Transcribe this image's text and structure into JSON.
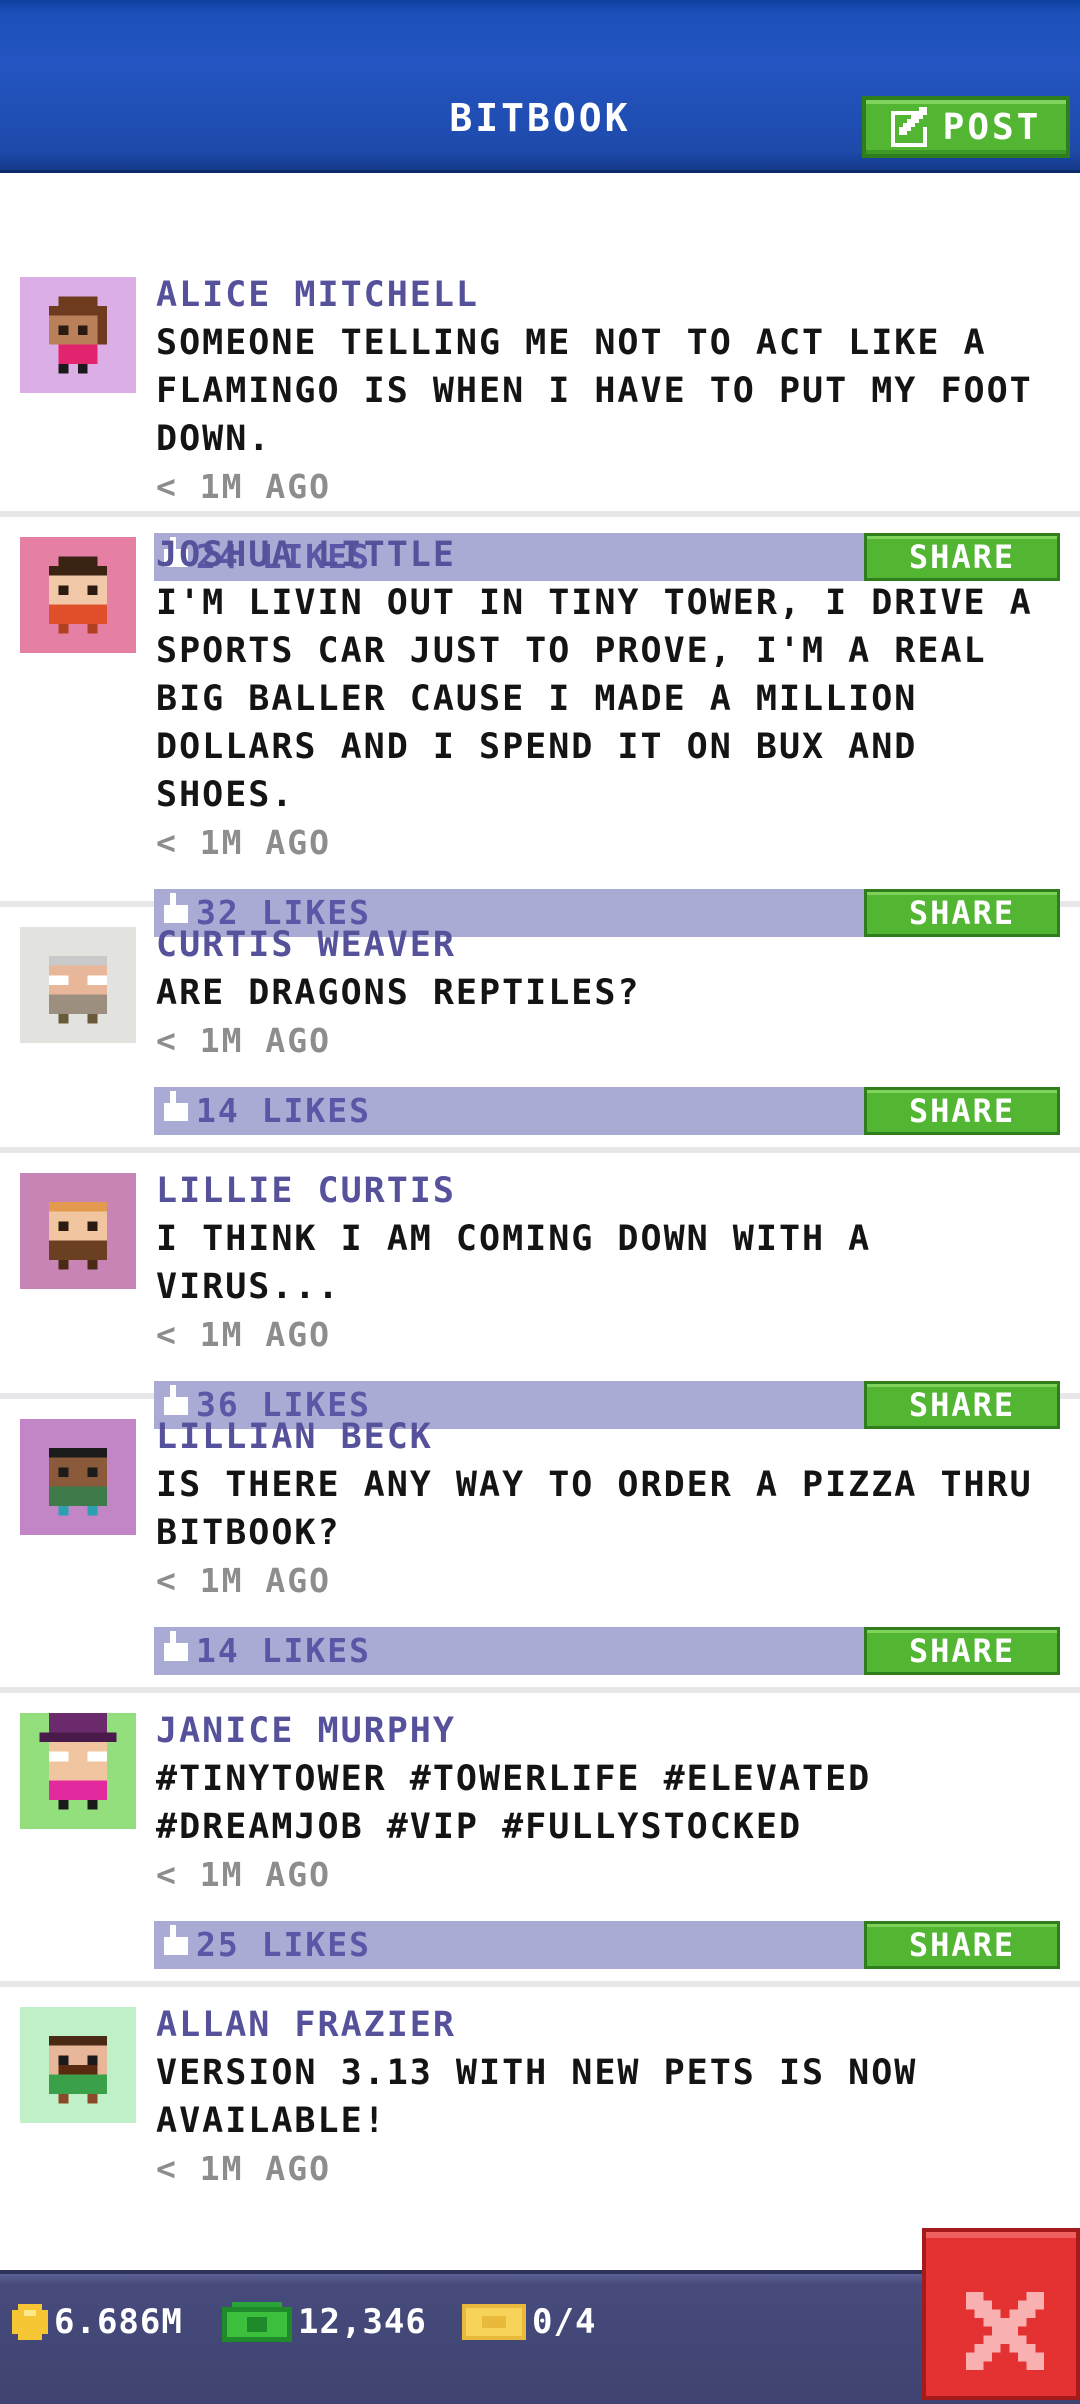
{
  "header": {
    "title": "BITBOOK",
    "post_label": "POST"
  },
  "colors": {
    "header_blue": "#1e4aab",
    "accent_green": "#53b633",
    "likes_bar": "#a9abd4",
    "author_purple": "#55519b",
    "close_red": "#e43131"
  },
  "posts": [
    {
      "author": "ALICE MITCHELL",
      "text": "SOMEONE TELLING ME NOT TO ACT LIKE A FLAMINGO IS WHEN I HAVE TO PUT MY FOOT DOWN.",
      "time": "< 1M AGO",
      "likes": "24 LIKES",
      "share_label": "SHARE",
      "avatar_bg": "#dcaee6"
    },
    {
      "author": "JOSHUA LITTLE",
      "text": "I'M LIVIN OUT IN TINY TOWER, I DRIVE A SPORTS CAR JUST TO PROVE, I'M A REAL BIG BALLER CAUSE I MADE A MILLION DOLLARS AND I SPEND IT ON BUX AND SHOES.",
      "time": "< 1M AGO",
      "likes": "32 LIKES",
      "share_label": "SHARE",
      "avatar_bg": "#e57fa3"
    },
    {
      "author": "CURTIS WEAVER",
      "text": "ARE DRAGONS REPTILES?",
      "time": "< 1M AGO",
      "likes": "14 LIKES",
      "share_label": "SHARE",
      "avatar_bg": "#e2e3df"
    },
    {
      "author": "LILLIE CURTIS",
      "text": "I THINK I AM COMING DOWN WITH A VIRUS...",
      "time": "< 1M AGO",
      "likes": "36 LIKES",
      "share_label": "SHARE",
      "avatar_bg": "#c784b4"
    },
    {
      "author": "LILLIAN BECK",
      "text": "IS THERE ANY WAY TO ORDER A PIZZA THRU BITBOOK?",
      "time": "< 1M AGO",
      "likes": "14 LIKES",
      "share_label": "SHARE",
      "avatar_bg": "#c285c6"
    },
    {
      "author": "JANICE MURPHY",
      "text": "#TINYTOWER #TOWERLIFE #ELEVATED #DREAMJOB #VIP #FULLYSTOCKED",
      "time": "< 1M AGO",
      "likes": "25 LIKES",
      "share_label": "SHARE",
      "avatar_bg": "#93df7e"
    },
    {
      "author": "ALLAN FRAZIER",
      "text": "VERSION 3.13 WITH NEW PETS IS NOW AVAILABLE!",
      "time": "< 1M AGO",
      "avatar_bg": "#bff0c7"
    }
  ],
  "status_bar": {
    "coins": "6.686M",
    "bux": "12,346",
    "tickets": "0/4"
  }
}
